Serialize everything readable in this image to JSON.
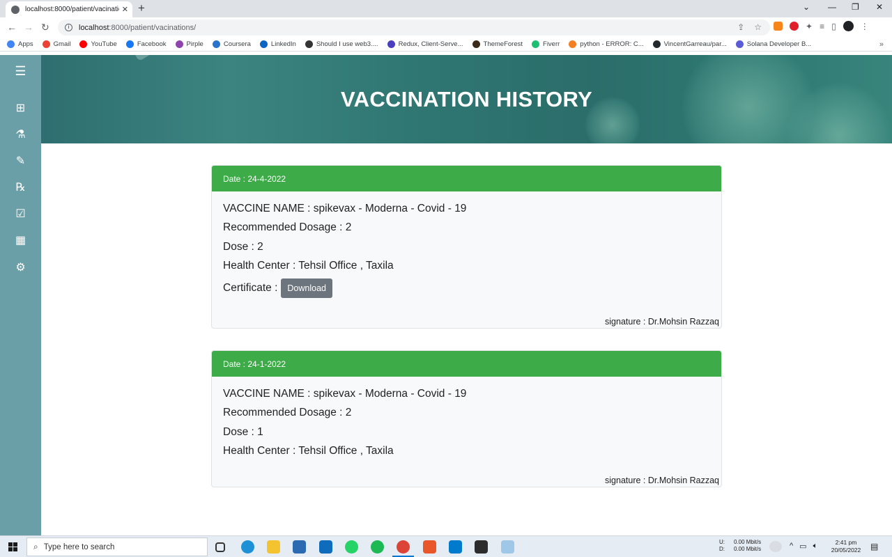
{
  "browser": {
    "tab_title": "localhost:8000/patient/vacination",
    "tab_close": "✕",
    "new_tab": "+",
    "url_host": "localhost",
    "url_path": ":8000/patient/vacinations/",
    "bookmarks": [
      {
        "label": "Apps",
        "color": "#4285f4"
      },
      {
        "label": "Gmail",
        "color": "#ea4335"
      },
      {
        "label": "YouTube",
        "color": "#ff0000"
      },
      {
        "label": "Facebook",
        "color": "#1877f2"
      },
      {
        "label": "Pirple",
        "color": "#8e44ad"
      },
      {
        "label": "Coursera",
        "color": "#2a73cc"
      },
      {
        "label": "LinkedIn",
        "color": "#0a66c2"
      },
      {
        "label": "Should I use web3....",
        "color": "#333333"
      },
      {
        "label": "Redux, Client-Serve...",
        "color": "#4b3fbe"
      },
      {
        "label": "ThemeForest",
        "color": "#3b2a1a"
      },
      {
        "label": "Fiverr",
        "color": "#1dbf73"
      },
      {
        "label": "python - ERROR: C...",
        "color": "#f48024"
      },
      {
        "label": "VincentGarreau/par...",
        "color": "#24292e"
      },
      {
        "label": "Solana Developer B...",
        "color": "#5b5bd6"
      }
    ],
    "bookmarks_more": "»"
  },
  "hero": {
    "title": "VACCINATION HISTORY"
  },
  "sidebar": {
    "items": [
      {
        "name": "menu-icon",
        "glyph": "☰"
      },
      {
        "name": "medical-kit-icon",
        "glyph": "⊞"
      },
      {
        "name": "flask-icon",
        "glyph": "⚗"
      },
      {
        "name": "syringe-icon",
        "glyph": "✎"
      },
      {
        "name": "prescription-icon",
        "glyph": "℞"
      },
      {
        "name": "calendar-check-icon",
        "glyph": "☑"
      },
      {
        "name": "calendar-icon",
        "glyph": "▦"
      },
      {
        "name": "gear-icon",
        "glyph": "⚙"
      }
    ]
  },
  "records": [
    {
      "date": "Date : 24-4-2022",
      "vaccine": "VACCINE NAME : spikevax - Moderna - Covid - 19",
      "recommended": "Recommended Dosage : 2",
      "dose": "Dose : 2",
      "center": "Health Center : Tehsil Office , Taxila",
      "certificate_label": "Certificate :",
      "download_label": "Download",
      "signature": "signature : Dr.Mohsin Razzaq"
    },
    {
      "date": "Date : 24-1-2022",
      "vaccine": "VACCINE NAME : spikevax - Moderna - Covid - 19",
      "recommended": "Recommended Dosage : 2",
      "dose": "Dose : 1",
      "center": "Health Center : Tehsil Office , Taxila",
      "signature": "signature : Dr.Mohsin Razzaq"
    }
  ],
  "taskbar": {
    "search_placeholder": "Type here to search",
    "net_up": "U:",
    "net_down": "D:",
    "net_up_val": "0.00 Mbit/s",
    "net_down_val": "0.00 Mbit/s",
    "time": "2:41 pm",
    "date": "20/05/2022"
  },
  "colors": {
    "accent_green": "#3dab48",
    "sidebar_teal": "#6a9fa8",
    "button_gray": "#6c757d"
  }
}
